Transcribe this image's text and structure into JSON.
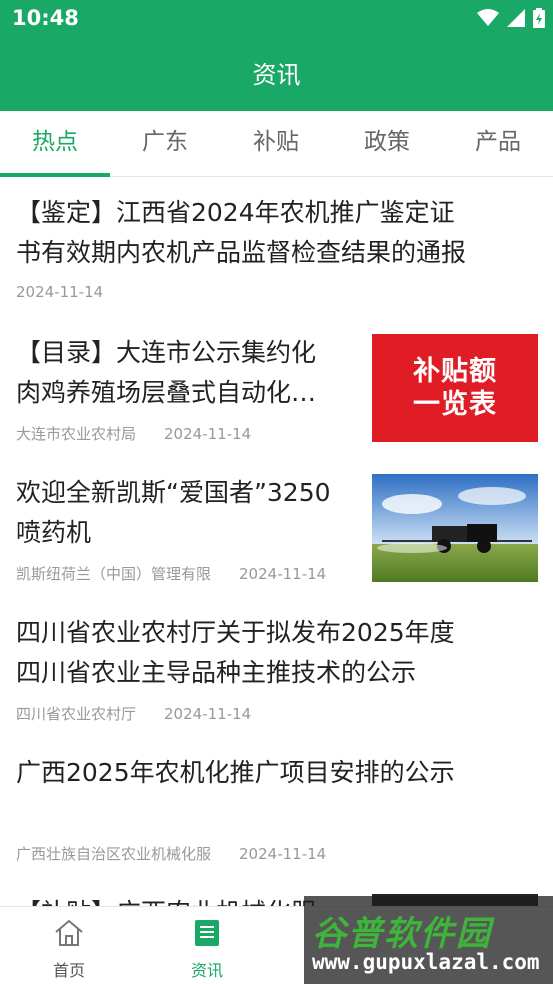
{
  "status": {
    "time": "10:48"
  },
  "header": {
    "title": "资讯"
  },
  "tabs": [
    {
      "label": "热点",
      "active": true
    },
    {
      "label": "广东"
    },
    {
      "label": "补贴"
    },
    {
      "label": "政策"
    },
    {
      "label": "产品"
    }
  ],
  "news": [
    {
      "title_line1": "【鉴定】江西省2024年农机推广鉴定证",
      "title_line2": "书有效期内农机产品监督检查结果的通报",
      "source": "",
      "date": "2024-11-14"
    },
    {
      "title_line1": "【目录】大连市公示集约化",
      "title_line2": "肉鸡养殖场层叠式自动化…",
      "source": "大连市农业农村局",
      "date": "2024-11-14",
      "thumb_line1": "补贴额",
      "thumb_line2": "一览表"
    },
    {
      "title_line1": "欢迎全新凯斯“爱国者”3250",
      "title_line2": "喷药机",
      "source": "凯斯纽荷兰（中国）管理有限",
      "date": "2024-11-14"
    },
    {
      "title_line1": "四川省农业农村厅关于拟发布2025年度",
      "title_line2": "四川省农业主导品种主推技术的公示",
      "source": "四川省农业农村厅",
      "date": "2024-11-14"
    },
    {
      "title_line1": "广西2025年农机化推广项目安排的公示",
      "source": "广西壮族自治区农业机械化服",
      "date": "2024-11-14"
    },
    {
      "title_line1": "【补贴】",
      "title_line1_rest": "广西农业机械化服"
    }
  ],
  "bottom_nav": [
    {
      "label": "首页",
      "icon": "home-icon"
    },
    {
      "label": "资讯",
      "icon": "news-icon",
      "active": true
    }
  ],
  "watermark": {
    "text": "谷普软件园",
    "url": "www.gupuxlazal.com"
  },
  "colors": {
    "brand": "#1aa866",
    "meta": "#999999",
    "thumb_red": "#e01d24"
  }
}
